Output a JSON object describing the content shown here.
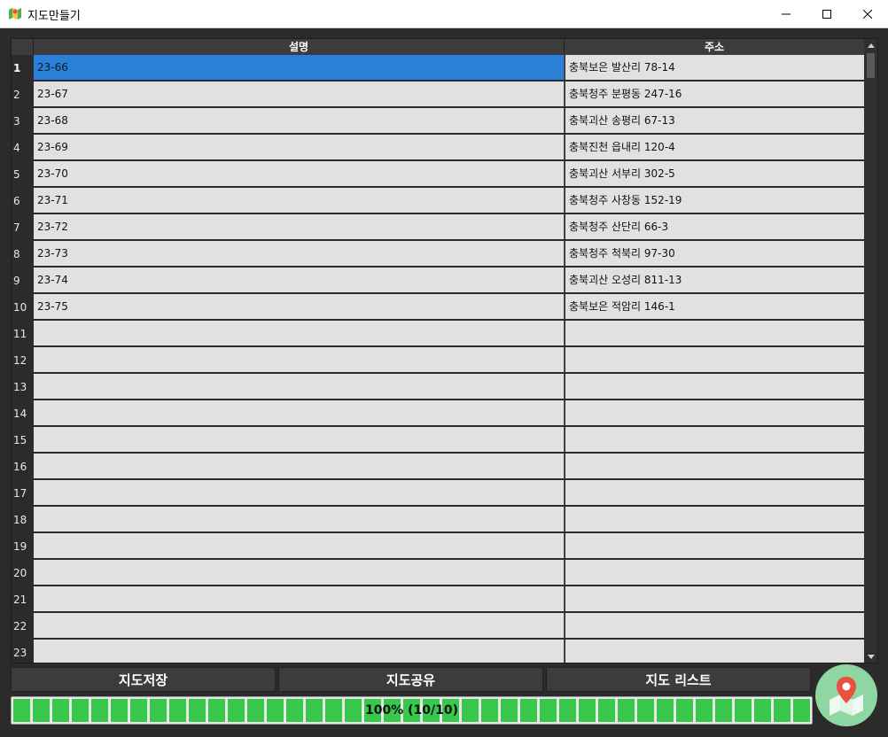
{
  "window": {
    "title": "지도만들기",
    "minimize_icon": "minimize-icon",
    "maximize_icon": "maximize-icon",
    "close_icon": "close-icon"
  },
  "table": {
    "columns": [
      "설명",
      "주소"
    ],
    "selected_row": 1,
    "rows": [
      {
        "num": "1",
        "desc": "23-66",
        "addr": "충북보은 발산리 78-14"
      },
      {
        "num": "2",
        "desc": "23-67",
        "addr": "충북청주 분평동 247-16"
      },
      {
        "num": "3",
        "desc": "23-68",
        "addr": "충북괴산 송평리 67-13"
      },
      {
        "num": "4",
        "desc": "23-69",
        "addr": "충북진천 읍내리 120-4"
      },
      {
        "num": "5",
        "desc": "23-70",
        "addr": "충북괴산 서부리 302-5"
      },
      {
        "num": "6",
        "desc": "23-71",
        "addr": "충북청주 사창동 152-19"
      },
      {
        "num": "7",
        "desc": "23-72",
        "addr": "충북청주 산단리 66-3"
      },
      {
        "num": "8",
        "desc": "23-73",
        "addr": "충북청주 척북리 97-30"
      },
      {
        "num": "9",
        "desc": "23-74",
        "addr": "충북괴산 오성리 811-13"
      },
      {
        "num": "10",
        "desc": "23-75",
        "addr": "충북보은 적암리 146-1"
      },
      {
        "num": "11",
        "desc": "",
        "addr": ""
      },
      {
        "num": "12",
        "desc": "",
        "addr": ""
      },
      {
        "num": "13",
        "desc": "",
        "addr": ""
      },
      {
        "num": "14",
        "desc": "",
        "addr": ""
      },
      {
        "num": "15",
        "desc": "",
        "addr": ""
      },
      {
        "num": "16",
        "desc": "",
        "addr": ""
      },
      {
        "num": "17",
        "desc": "",
        "addr": ""
      },
      {
        "num": "18",
        "desc": "",
        "addr": ""
      },
      {
        "num": "19",
        "desc": "",
        "addr": ""
      },
      {
        "num": "20",
        "desc": "",
        "addr": ""
      },
      {
        "num": "21",
        "desc": "",
        "addr": ""
      },
      {
        "num": "22",
        "desc": "",
        "addr": ""
      },
      {
        "num": "23",
        "desc": "",
        "addr": ""
      }
    ]
  },
  "buttons": {
    "save_label": "지도저장",
    "share_label": "지도공유",
    "list_label": "지도 리스트"
  },
  "progress": {
    "percent": 100,
    "label": "100% (10/10)"
  },
  "colors": {
    "selection": "#2a7fd7",
    "progress_fill": "#37c84c",
    "map_button_bg": "#8ed6a2",
    "map_pin": "#e9503f"
  },
  "map_button_icon": "map-pin-icon"
}
